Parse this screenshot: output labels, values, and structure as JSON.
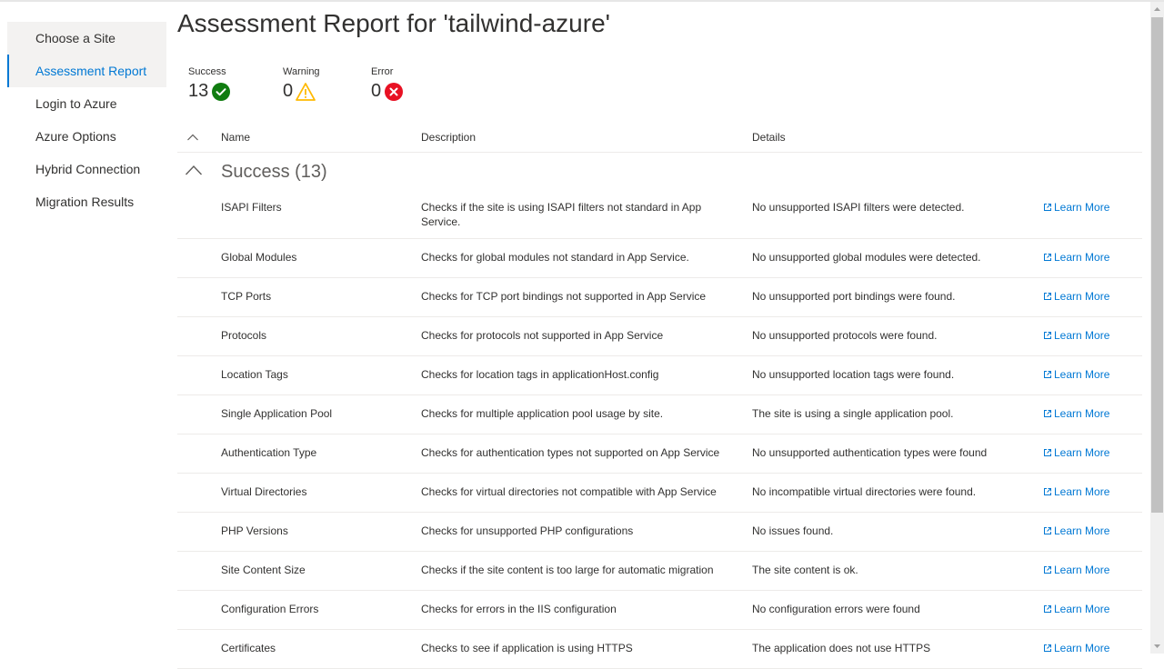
{
  "nav": {
    "items": [
      {
        "label": "Choose a Site"
      },
      {
        "label": "Assessment Report"
      },
      {
        "label": "Login to Azure"
      },
      {
        "label": "Azure Options"
      },
      {
        "label": "Hybrid Connection"
      },
      {
        "label": "Migration Results"
      }
    ],
    "active": "Assessment Report"
  },
  "page": {
    "title": "Assessment Report for 'tailwind-azure'"
  },
  "summary": {
    "success": {
      "label": "Success",
      "count": "13",
      "color": "#107c10"
    },
    "warning": {
      "label": "Warning",
      "count": "0",
      "color": "#ffb900"
    },
    "error": {
      "label": "Error",
      "count": "0",
      "color": "#e81123"
    }
  },
  "table": {
    "headers": {
      "name": "Name",
      "description": "Description",
      "details": "Details"
    },
    "group_label": "Success (13)",
    "link_label": "Learn More",
    "rows": [
      {
        "name": "ISAPI Filters",
        "description": "Checks if the site is using ISAPI filters not standard in App Service.",
        "details": "No unsupported ISAPI filters were detected."
      },
      {
        "name": "Global Modules",
        "description": "Checks for global modules not standard in App Service.",
        "details": "No unsupported global modules were detected."
      },
      {
        "name": "TCP Ports",
        "description": "Checks for TCP port bindings not supported in App Service",
        "details": "No unsupported port bindings were found."
      },
      {
        "name": "Protocols",
        "description": "Checks for protocols not supported in App Service",
        "details": "No unsupported protocols were found."
      },
      {
        "name": "Location Tags",
        "description": "Checks for location tags in applicationHost.config",
        "details": "No unsupported location tags were found."
      },
      {
        "name": "Single Application Pool",
        "description": "Checks for multiple application pool usage by site.",
        "details": "The site is using a single application pool."
      },
      {
        "name": "Authentication Type",
        "description": "Checks for authentication types not supported on App Service",
        "details": "No unsupported authentication types were found"
      },
      {
        "name": "Virtual Directories",
        "description": "Checks for virtual directories not compatible with App Service",
        "details": "No incompatible virtual directories were found."
      },
      {
        "name": "PHP Versions",
        "description": "Checks for unsupported PHP configurations",
        "details": "No issues found."
      },
      {
        "name": "Site Content Size",
        "description": "Checks if the site content is too large for automatic migration",
        "details": "The site content is ok."
      },
      {
        "name": "Configuration Errors",
        "description": "Checks for errors in the IIS configuration",
        "details": "No configuration errors were found"
      },
      {
        "name": "Certificates",
        "description": "Checks to see if application is using HTTPS",
        "details": "The application does not use HTTPS"
      }
    ]
  },
  "colors": {
    "accent": "#0078d4"
  }
}
